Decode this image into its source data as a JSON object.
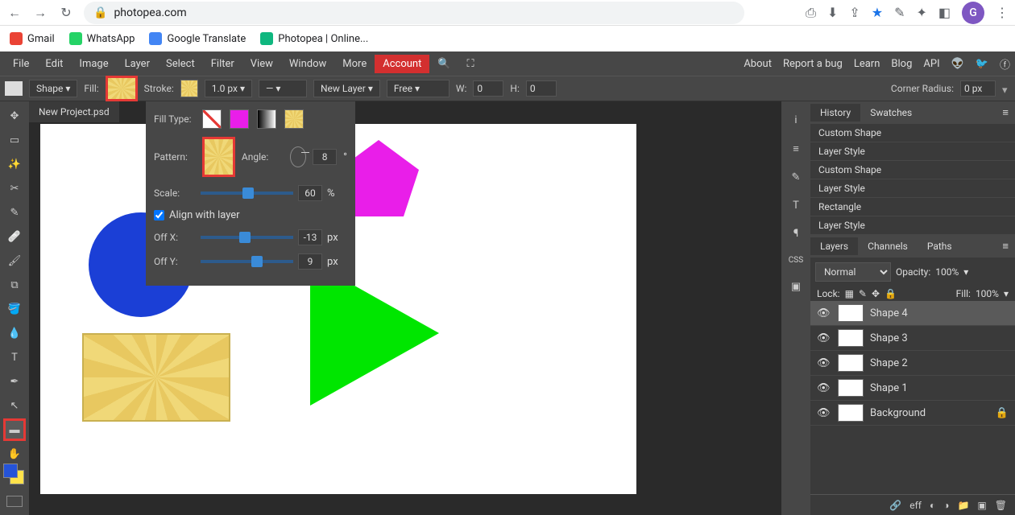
{
  "browser": {
    "url": "photopea.com",
    "avatar_letter": "G",
    "bookmarks": [
      {
        "label": "Gmail",
        "color": "#ea4335"
      },
      {
        "label": "WhatsApp",
        "color": "#25d366"
      },
      {
        "label": "Google Translate",
        "color": "#4285f4"
      },
      {
        "label": "Photopea | Online...",
        "color": "#0fb77f"
      }
    ]
  },
  "menu": {
    "items": [
      "File",
      "Edit",
      "Image",
      "Layer",
      "Select",
      "Filter",
      "View",
      "Window",
      "More"
    ],
    "account": "Account",
    "right": [
      "About",
      "Report a bug",
      "Learn",
      "Blog",
      "API"
    ]
  },
  "toolbar": {
    "mode_label": "Shape",
    "fill_label": "Fill:",
    "stroke_label": "Stroke:",
    "stroke_width": "1.0 px",
    "layer_mode": "New Layer",
    "constrain": "Free",
    "w_label": "W:",
    "w_val": "0",
    "h_label": "H:",
    "h_val": "0",
    "radius_label": "Corner Radius:",
    "radius_val": "0 px"
  },
  "tab_name": "New Project.psd",
  "fill_panel": {
    "type_label": "Fill Type:",
    "pattern_label": "Pattern:",
    "angle_label": "Angle:",
    "angle_val": "8",
    "angle_unit": "°",
    "scale_label": "Scale:",
    "scale_val": "60",
    "scale_unit": "%",
    "align_label": "Align with layer",
    "offx_label": "Off X:",
    "offx_val": "-13",
    "offy_label": "Off Y:",
    "offy_val": "9",
    "off_unit": "px"
  },
  "history": {
    "tab_history": "History",
    "tab_swatches": "Swatches",
    "items": [
      "Custom Shape",
      "Layer Style",
      "Custom Shape",
      "Layer Style",
      "Rectangle",
      "Layer Style"
    ]
  },
  "layers": {
    "tab_layers": "Layers",
    "tab_channels": "Channels",
    "tab_paths": "Paths",
    "blend": "Normal",
    "opacity_label": "Opacity:",
    "opacity_val": "100%",
    "lock_label": "Lock:",
    "fill_label": "Fill:",
    "fill_val": "100%",
    "items": [
      {
        "name": "Shape 4"
      },
      {
        "name": "Shape 3"
      },
      {
        "name": "Shape 2"
      },
      {
        "name": "Shape 1"
      },
      {
        "name": "Background"
      }
    ]
  },
  "right_icons": [
    "i",
    "≡",
    "✎",
    "T",
    "¶",
    "CSS",
    "▣"
  ],
  "footer": {
    "eff": "eff"
  }
}
